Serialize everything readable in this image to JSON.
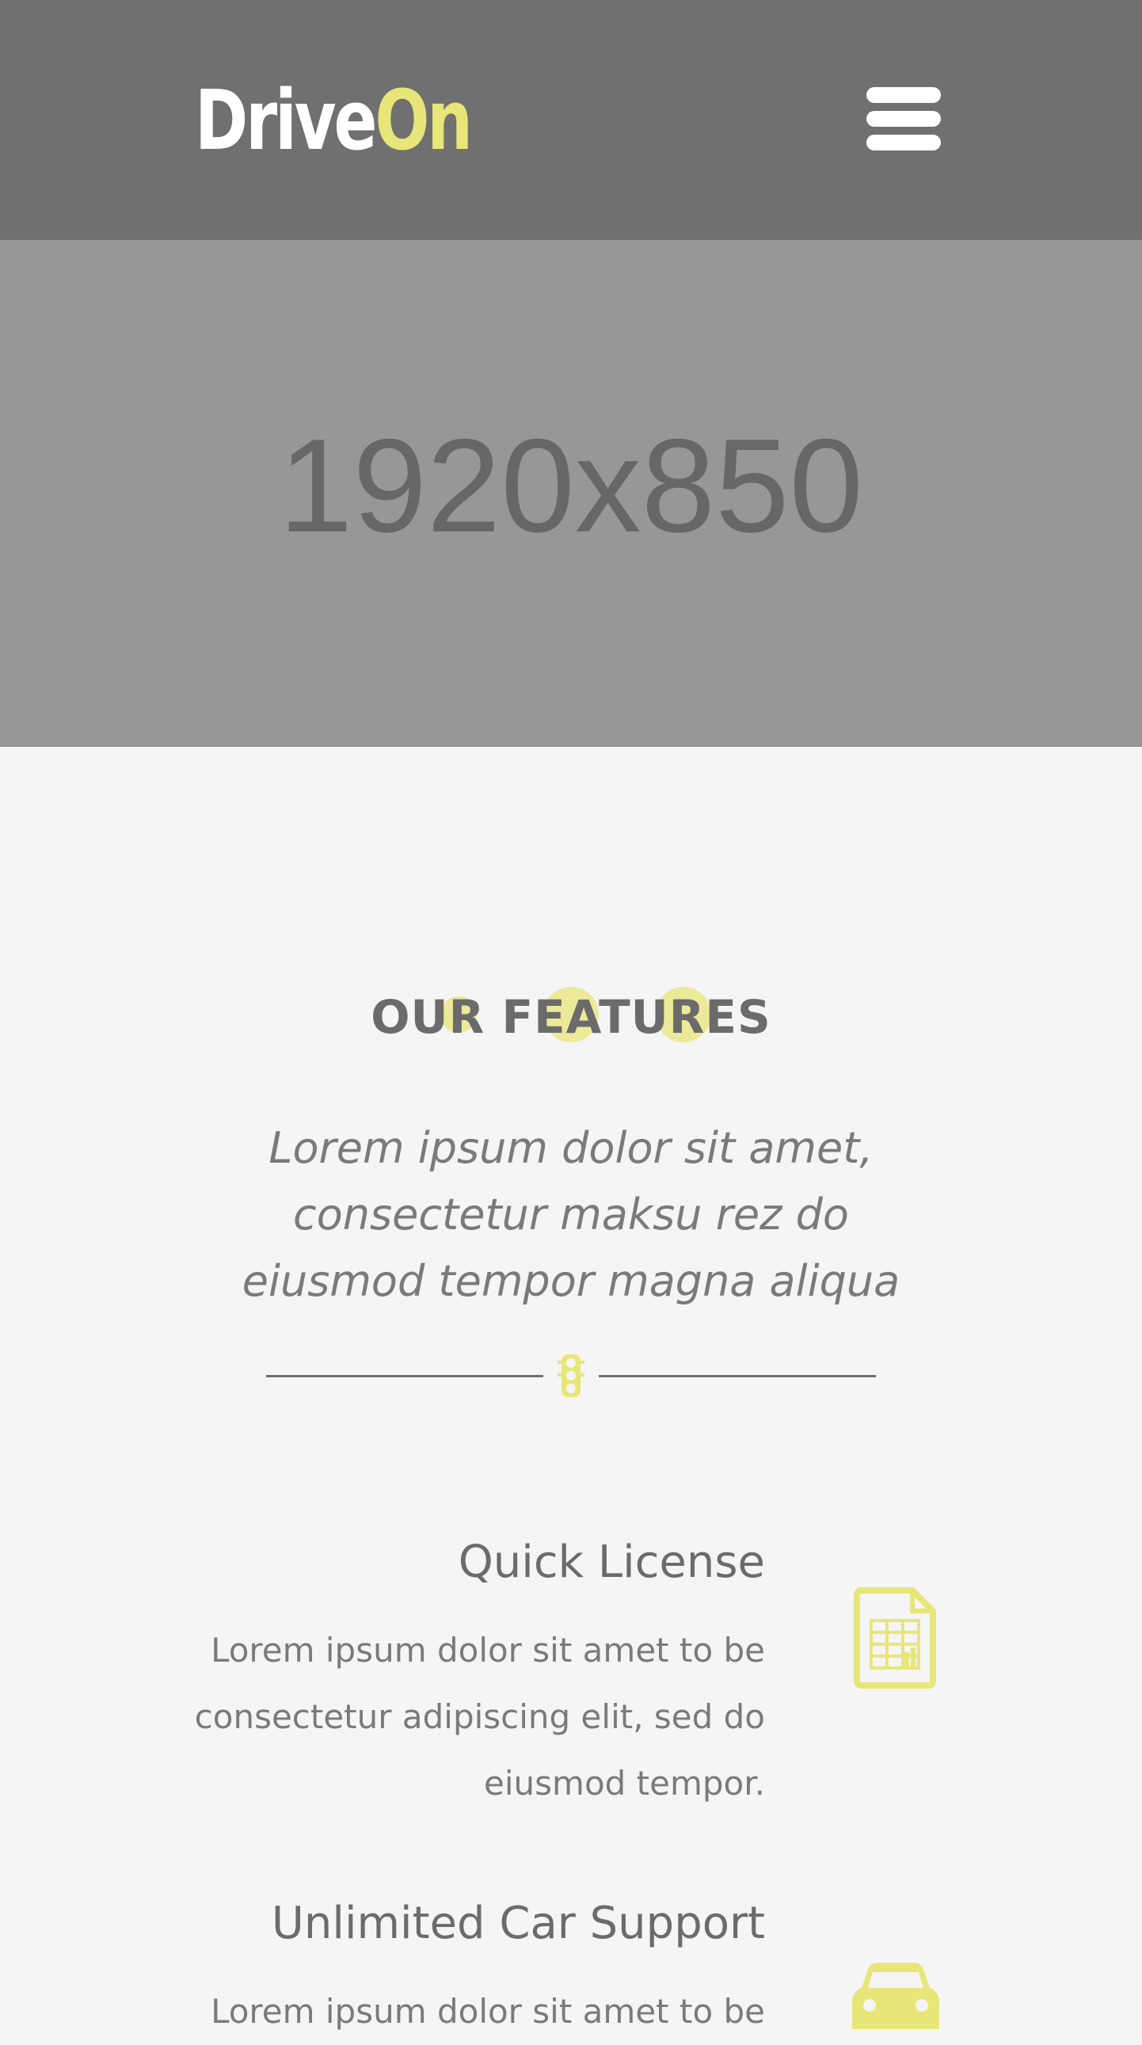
{
  "header": {
    "logo": {
      "text_part1": "Drive",
      "text_part2": "On"
    },
    "menu_icon": "hamburger-menu-icon"
  },
  "hero": {
    "placeholder_text": "1920x850"
  },
  "features_section": {
    "title": "OUR FEATURES",
    "subtitle": "Lorem ipsum dolor sit amet, consectetur maksu rez do eiusmod tempor magna aliqua",
    "divider_icon": "traffic-light-icon",
    "items": [
      {
        "title": "Quick License",
        "text": "Lorem ipsum dolor sit amet to be consectetur adipiscing elit, sed do eiusmod tempor.",
        "icon": "document-icon"
      },
      {
        "title": "Unlimited Car Support",
        "text": "Lorem ipsum dolor sit amet to be",
        "icon": "car-icon"
      }
    ]
  },
  "colors": {
    "accent": "#e8e678",
    "header_bg": "#707070",
    "hero_bg": "#979797",
    "page_bg": "#f5f5f5",
    "text": "#6b6b6b"
  }
}
